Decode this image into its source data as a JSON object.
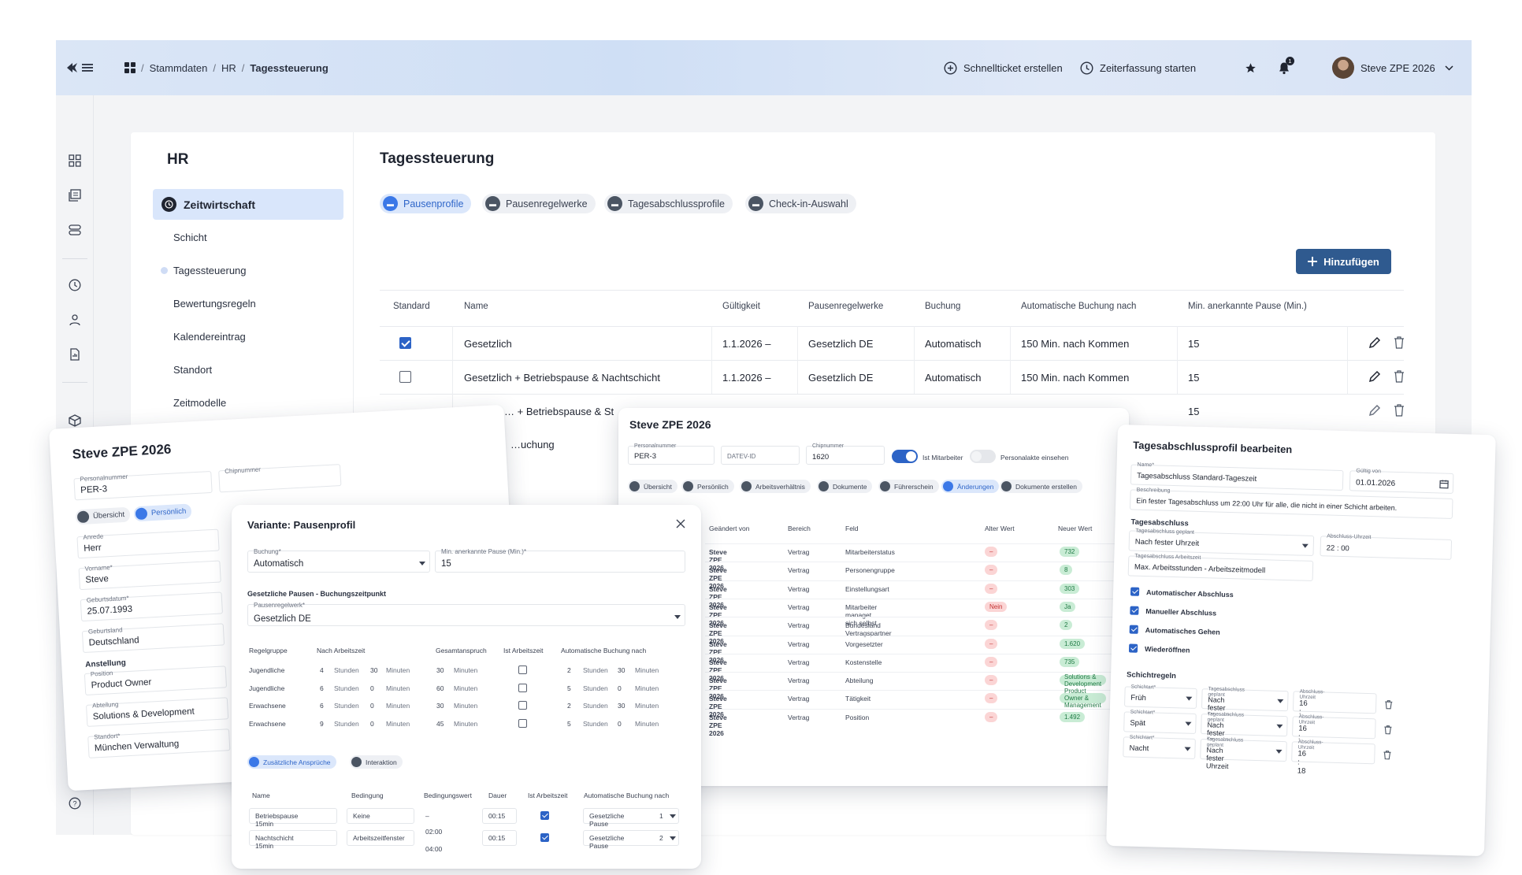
{
  "topbar": {
    "breadcrumb": [
      "Stammdaten",
      "HR",
      "Tagessteuerung"
    ],
    "quick_ticket": "Schnellticket erstellen",
    "time_tracking": "Zeiterfassung starten",
    "notification_count": "1",
    "user_name": "Steve ZPE 2026"
  },
  "sidebar": {
    "section_title": "HR",
    "group": "Zeitwirtschaft",
    "items": [
      "Schicht",
      "Tagessteuerung",
      "Bewertungsregeln",
      "Kalendereintrag",
      "Standort",
      "Zeitmodelle"
    ]
  },
  "main": {
    "title": "Tagessteuerung",
    "tabs": [
      "Pausenprofile",
      "Pausenregelwerke",
      "Tagesabschlussprofile",
      "Check-in-Auswahl"
    ],
    "add_button": "Hinzufügen",
    "columns": [
      "Standard",
      "Name",
      "Gültigkeit",
      "Pausenregelwerke",
      "Buchung",
      "Automatische Buchung nach",
      "Min. anerkannte Pause (Min.)"
    ],
    "rows": [
      {
        "standard": true,
        "name": "Gesetzlich",
        "validity": "1.1.2026 –",
        "rules": "Gesetzlich DE",
        "booking": "Automatisch",
        "auto": "150 Min. nach Kommen",
        "min": "15"
      },
      {
        "standard": false,
        "name": "Gesetzlich + Betriebspause & Nachtschicht",
        "validity": "1.1.2026 –",
        "rules": "Gesetzlich DE",
        "booking": "Automatisch",
        "auto": "150 Min. nach Kommen",
        "min": "15"
      },
      {
        "standard": false,
        "name": "… + Betriebspause & St",
        "validity": "",
        "rules": "",
        "booking": "",
        "auto": "",
        "min": "15"
      },
      {
        "standard": false,
        "name": "…uchung",
        "validity": "",
        "rules": "",
        "booking": "",
        "auto": "",
        "min": ""
      }
    ]
  },
  "person_card": {
    "title": "Steve ZPE 2026",
    "personalnummer_label": "Personalnummer",
    "personalnummer": "PER-3",
    "chipnummer_label": "Chipnummer",
    "tabs": [
      "Übersicht",
      "Persönlich"
    ],
    "anrede_label": "Anrede",
    "anrede": "Herr",
    "vorname_label": "Vorname*",
    "vorname": "Steve",
    "geburtsdatum_label": "Geburtsdatum*",
    "geburtsdatum": "25.07.1993",
    "geburtsland_label": "Geburtsland",
    "geburtsland": "Deutschland",
    "anstellung": "Anstellung",
    "position_label": "Position",
    "position": "Product Owner",
    "abteilung_label": "Abteilung",
    "abteilung": "Solutions & Development",
    "standort_label": "Standort*",
    "standort": "München Verwaltung"
  },
  "pause_modal": {
    "title": "Variante: Pausenprofil",
    "buchung_label": "Buchung*",
    "buchung": "Automatisch",
    "minpause_label": "Min. anerkannte Pause (Min.)*",
    "minpause": "15",
    "section": "Gesetzliche Pausen - Buchungszeitpunkt",
    "regelwerk_label": "Pausenregelwerk*",
    "regelwerk": "Gesetzlich DE",
    "columns": [
      "Regelgruppe",
      "Nach Arbeitszeit",
      "Gesamtanspruch",
      "Ist Arbeitszeit",
      "Automatische Buchung nach"
    ],
    "unit_h": "Stunden",
    "unit_m": "Minuten",
    "rows": [
      {
        "group": "Jugendliche",
        "h": "4",
        "m": "30",
        "total": "30",
        "ah": "2",
        "am": "30"
      },
      {
        "group": "Jugendliche",
        "h": "6",
        "m": "0",
        "total": "60",
        "ah": "5",
        "am": "0"
      },
      {
        "group": "Erwachsene",
        "h": "6",
        "m": "0",
        "total": "30",
        "ah": "2",
        "am": "30"
      },
      {
        "group": "Erwachsene",
        "h": "9",
        "m": "0",
        "total": "45",
        "ah": "5",
        "am": "0"
      }
    ],
    "tabs": [
      "Zusätzliche Ansprüche",
      "Interaktion"
    ],
    "columns2": [
      "Name",
      "Bedingung",
      "Bedingungswert",
      "Dauer",
      "Ist Arbeitszeit",
      "Automatische Buchung nach"
    ],
    "rows2": [
      {
        "name": "Betriebspause 15min",
        "cond": "Keine",
        "cval": "–",
        "dur": "00:15",
        "book": "Gesetzliche Pause",
        "n": "1"
      },
      {
        "name": "Nachtschicht 15min",
        "cond": "Arbeitszeitfenster",
        "cval": "02:00",
        "cval2": "04:00",
        "dur": "00:15",
        "book": "Gesetzliche Pause",
        "n": "2"
      }
    ]
  },
  "changes_card": {
    "title": "Steve ZPE 2026",
    "personalnummer_label": "Personalnummer",
    "personalnummer": "PER-3",
    "datev_label": "DATEV-ID",
    "chip_label": "Chipnummer",
    "chip": "1620",
    "toggle1": "Ist Mitarbeiter",
    "toggle2": "Personalakte einsehen",
    "tabs": [
      "Übersicht",
      "Persönlich",
      "Arbeitsverhältnis",
      "Dokumente",
      "Führerschein",
      "Änderungen",
      "Dokumente erstellen"
    ],
    "columns": [
      "Geändert von",
      "Bereich",
      "Feld",
      "Alter Wert",
      "Neuer Wert"
    ],
    "rows": [
      {
        "by": "Steve ZPE 2026",
        "area": "Vertrag",
        "field": "Mitarbeiterstatus",
        "old": "–",
        "new": "732"
      },
      {
        "by": "Steve ZPE 2026",
        "area": "Vertrag",
        "field": "Personengruppe",
        "old": "–",
        "new": "8"
      },
      {
        "by": "Steve ZPE 2026",
        "area": "Vertrag",
        "field": "Einstellungsart",
        "old": "–",
        "new": "303"
      },
      {
        "by": "Steve ZPE 2026",
        "area": "Vertrag",
        "field": "Mitarbeiter managet sich selbst",
        "old": "Nein",
        "new": "Ja"
      },
      {
        "by": "Steve ZPE 2026",
        "area": "Vertrag",
        "field": "Bundesland Vertragspartner",
        "old": "–",
        "new": "2"
      },
      {
        "by": "Steve ZPE 2026",
        "area": "Vertrag",
        "field": "Vorgesetzter",
        "old": "–",
        "new": "1.620"
      },
      {
        "by": "Steve ZPE 2026",
        "area": "Vertrag",
        "field": "Kostenstelle",
        "old": "–",
        "new": "735"
      },
      {
        "by": "Steve ZPE 2026",
        "area": "Vertrag",
        "field": "Abteilung",
        "old": "–",
        "new": "Solutions & Development"
      },
      {
        "by": "Steve ZPE 2026",
        "area": "Vertrag",
        "field": "Tätigkeit",
        "old": "–",
        "new": "Product Owner & Management"
      },
      {
        "by": "Steve ZPE 2026",
        "area": "Vertrag",
        "field": "Position",
        "old": "–",
        "new": "1.492"
      }
    ]
  },
  "closing_card": {
    "title": "Tagesabschlussprofil bearbeiten",
    "name_label": "Name*",
    "name": "Tagesabschluss Standard-Tageszeit",
    "valid_label": "Gültig von",
    "valid": "01.01.2026",
    "desc_label": "Beschreibung",
    "desc": "Ein fester Tagesabschluss um 22:00 Uhr für alle, die nicht in einer Schicht arbeiten.",
    "section1": "Tagesabschluss",
    "planned_label": "Tagesabschluss geplant",
    "planned": "Nach fester Uhrzeit",
    "time_label": "Abschluss-Uhrzeit",
    "time": "22 : 00",
    "work_label": "Tagesabschluss Arbeitszeit",
    "work": "Max. Arbeitsstunden - Arbeitszeitmodell",
    "checks": [
      "Automatischer Abschluss",
      "Manueller Abschluss",
      "Automatisches Gehen",
      "Wiederöffnen"
    ],
    "section2": "Schichtregeln",
    "shift_label": "Schichtart*",
    "shifts": [
      {
        "type": "Früh",
        "planned": "Nach fester Uhrzeit",
        "time": "16 : 18"
      },
      {
        "type": "Spät",
        "planned": "Nach fester Uhrzeit",
        "time": "16 : 18"
      },
      {
        "type": "Nacht",
        "planned": "Nach fester Uhrzeit",
        "time": "16 : 18"
      }
    ]
  },
  "colors": {
    "accent": "#2c63c6",
    "primary_button": "#2f5a8f",
    "topbar": "#d6e2f5"
  }
}
